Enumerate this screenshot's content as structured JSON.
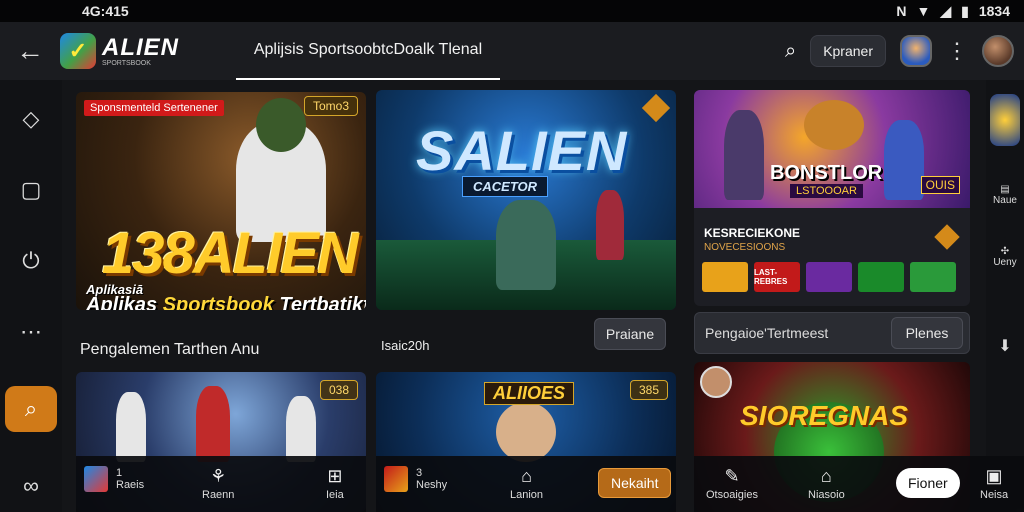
{
  "status": {
    "time": "4G:415",
    "right_clock": "1834",
    "icons": [
      "nfc-icon",
      "wifi-icon",
      "signal-icon",
      "battery-icon"
    ]
  },
  "appbar": {
    "logo_text": "ALIEN",
    "logo_sub": "SPORTSBOOK",
    "title": "Aplijsis SportsoobtcDoalk Tlenal",
    "account_button": "Kpraner"
  },
  "sidebar": {
    "items": [
      "chat-icon",
      "tv-icon",
      "power-icon",
      "grid-icon",
      "search-icon",
      "link-icon"
    ]
  },
  "cards": {
    "c1": {
      "tag": "Sponsmenteld Sertenener",
      "badge": "Tomo3",
      "big_title": "138ALIEN",
      "sub1": "Aplikasiā",
      "sub2_pre": "Aplikas ",
      "sub2_highlight": "Sportsbook",
      "sub2_post": " Tertbatikt",
      "caption": "Pengalemen Tarthen Anu"
    },
    "c2": {
      "logo": "SALIEN",
      "sub": "CACETOR",
      "caption": "Isaic20h",
      "button": "Praiane"
    },
    "c3": {
      "logo": "BONSTLOR",
      "logo_sub": "LSTOOOAR",
      "logo_right": "OUIS",
      "title": "KESRECIEKONE",
      "sub": "NOVECESIOONS",
      "tiles": [
        "",
        "LAST-REBRES",
        "",
        "",
        ""
      ],
      "field_label": "Pengaioe'Tertmeest",
      "field_button": "Plenes"
    },
    "c4": {
      "badge": "038"
    },
    "c5": {
      "title": "ALIIOES",
      "badge": "385"
    },
    "c6": {
      "title": "SIOREGNAS"
    }
  },
  "rightrail": {
    "items": [
      "Naue",
      "Ueny"
    ]
  },
  "bottom": {
    "left": [
      {
        "count": "1",
        "label": "Raeis"
      },
      {
        "label": "Raenn"
      },
      {
        "label": "Ieia"
      }
    ],
    "middle": [
      {
        "count": "3",
        "label": "Neshy"
      },
      {
        "label": "Lanion"
      },
      {
        "button": "Nekaiht"
      }
    ],
    "right": [
      {
        "label": "Otsoaigies"
      },
      {
        "label": "Niasoio"
      },
      {
        "button": "Fioner"
      },
      {
        "label": "Neisa"
      }
    ]
  },
  "colors": {
    "accent": "#d07a18",
    "background": "#141518",
    "gold": "#ffcb2a"
  }
}
